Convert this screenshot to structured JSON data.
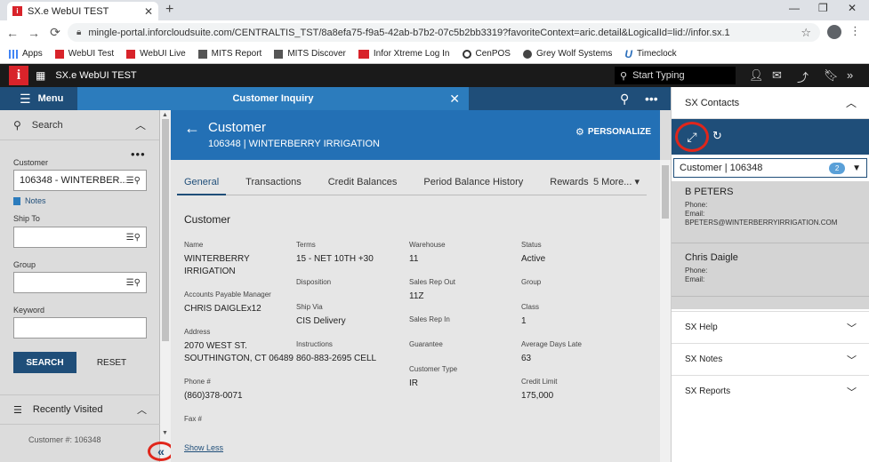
{
  "browser": {
    "tab_title": "SX.e WebUI TEST",
    "tab_favicon": "i",
    "url": "mingle-portal.inforcloudsuite.com/CENTRALTIS_TST/8a8efa75-f9a5-42ab-b7b2-07c5b2bb3319?favoriteContext=aric.detail&LogicalId=lid://infor.sx.1",
    "bookmarks": [
      {
        "label": "Apps"
      },
      {
        "label": "WebUI Test"
      },
      {
        "label": "WebUI Live"
      },
      {
        "label": "MITS Report"
      },
      {
        "label": "MITS Discover"
      },
      {
        "label": "Infor Xtreme Log In"
      },
      {
        "label": "CenPOS"
      },
      {
        "label": "Grey Wolf Systems"
      },
      {
        "label": "Timeclock"
      }
    ]
  },
  "app": {
    "title": "SX.e WebUI TEST",
    "logo_letter": "i",
    "search_placeholder": "Start Typing"
  },
  "menu": {
    "label": "Menu"
  },
  "inquiry": {
    "title": "Customer Inquiry"
  },
  "search_panel": {
    "heading": "Search",
    "customer_label": "Customer",
    "customer_value": "106348 - WINTERBER...",
    "notes_label": "Notes",
    "shipto_label": "Ship To",
    "group_label": "Group",
    "keyword_label": "Keyword",
    "search_button": "SEARCH",
    "reset_button": "RESET",
    "recent_heading": "Recently Visited",
    "recent_peek": "Customer #: 106348"
  },
  "customer": {
    "title": "Customer",
    "subtitle": "106348 | WINTERBERRY IRRIGATION",
    "personalize": "PERSONALIZE",
    "tabs": [
      "General",
      "Transactions",
      "Credit Balances",
      "Period Balance History",
      "Rewards"
    ],
    "more_tabs": "5 More...",
    "section_title": "Customer",
    "fields": {
      "name_label": "Name",
      "name": "WINTERBERRY\nIRRIGATION",
      "ap_label": "Accounts Payable Manager",
      "ap": "CHRIS DAIGLEx12",
      "address_label": "Address",
      "address": "2070 WEST ST.\nSOUTHINGTON, CT 06489",
      "phone_label": "Phone #",
      "phone": "(860)378-0071",
      "fax_label": "Fax #",
      "terms_label": "Terms",
      "terms": "15 - NET 10TH +30",
      "disposition_label": "Disposition",
      "shipvia_label": "Ship Via",
      "shipvia": "CIS Delivery",
      "instructions_label": "Instructions",
      "instructions": "860-883-2695 CELL",
      "warehouse_label": "Warehouse",
      "warehouse": "11",
      "salesout_label": "Sales Rep Out",
      "salesout": "11Z",
      "salesin_label": "Sales Rep In",
      "guarantee_label": "Guarantee",
      "custtype_label": "Customer Type",
      "custtype": "IR",
      "status_label": "Status",
      "status": "Active",
      "group_label": "Group",
      "class_label": "Class",
      "class": "1",
      "avgdays_label": "Average Days Late",
      "avgdays": "63",
      "credit_label": "Credit Limit",
      "credit": "175,000"
    },
    "show_less": "Show Less"
  },
  "contacts_panel": {
    "heading": "SX Contacts",
    "selector_value": "Customer | 106348",
    "badge_count": "2",
    "contacts": [
      {
        "name": "B PETERS",
        "phone_label": "Phone:",
        "email_label": "Email:",
        "email": "BPETERS@WINTERBERRYIRRIGATION.COM"
      },
      {
        "name": "Chris Daigle",
        "phone_label": "Phone:",
        "email_label": "Email:",
        "email": ""
      }
    ],
    "sections": [
      "SX Help",
      "SX Notes",
      "SX Reports"
    ]
  },
  "colors": {
    "brand_red": "#d8232a",
    "header_blue": "#1f4e79",
    "customer_header_blue": "#2370b5",
    "highlight_circle": "#e0261b"
  }
}
